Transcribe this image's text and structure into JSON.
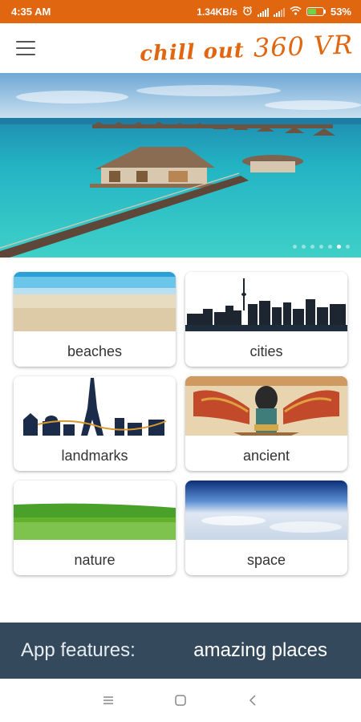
{
  "status_bar": {
    "time": "4:35 AM",
    "network_speed": "1.34KB/s",
    "battery": "53%",
    "battery_level": 0.53,
    "icons": [
      "alarm-icon",
      "signal-icon",
      "signal-icon",
      "wifi-icon",
      "battery-icon"
    ]
  },
  "app_bar": {
    "menu_icon": "menu-icon",
    "title_script": "chill out",
    "title_main": "360 VR",
    "accent_color": "#e0660f"
  },
  "carousel": {
    "slide_count": 7,
    "active_index": 5
  },
  "categories": [
    {
      "label": "beaches"
    },
    {
      "label": "cities"
    },
    {
      "label": "landmarks"
    },
    {
      "label": "ancient"
    },
    {
      "label": "nature"
    },
    {
      "label": "space"
    }
  ],
  "features": {
    "label": "App features:",
    "value": "amazing places",
    "background": "#344a5c"
  },
  "nav_bar": {
    "icons": [
      "recents-icon",
      "home-icon",
      "back-icon"
    ]
  }
}
